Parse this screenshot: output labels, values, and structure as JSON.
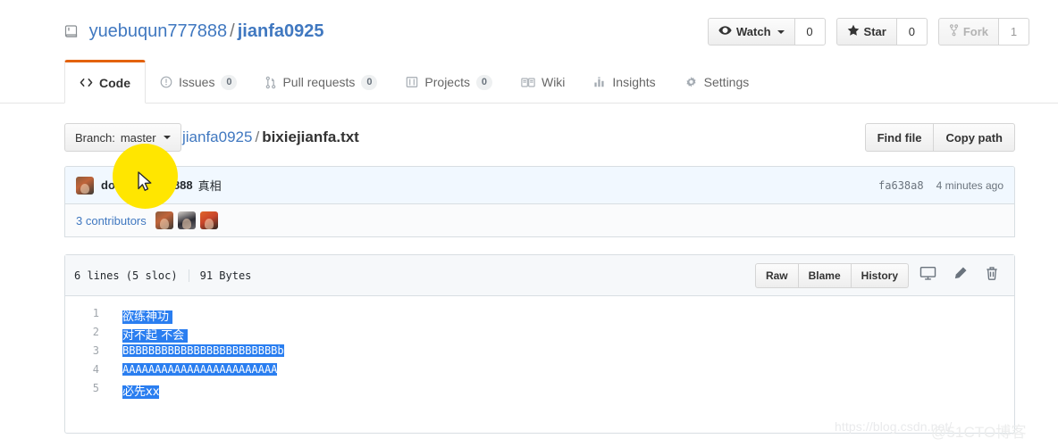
{
  "repo": {
    "owner": "yuebuqun777888",
    "separator": "/",
    "name": "jianfa0925",
    "icon": "repo-book-icon"
  },
  "actions": [
    {
      "label": "Watch",
      "count": "0",
      "icon": "eye-icon",
      "has_caret": true,
      "disabled": false
    },
    {
      "label": "Star",
      "count": "0",
      "icon": "star-icon",
      "has_caret": false,
      "disabled": false
    },
    {
      "label": "Fork",
      "count": "1",
      "icon": "fork-icon",
      "has_caret": false,
      "disabled": true
    }
  ],
  "nav": {
    "tabs": [
      {
        "label": "Code",
        "count": null,
        "icon": "code-icon",
        "selected": true
      },
      {
        "label": "Issues",
        "count": "0",
        "icon": "issue-opened-icon",
        "selected": false
      },
      {
        "label": "Pull requests",
        "count": "0",
        "icon": "git-pull-request-icon",
        "selected": false
      },
      {
        "label": "Projects",
        "count": "0",
        "icon": "project-board-icon",
        "selected": false
      },
      {
        "label": "Wiki",
        "count": null,
        "icon": "book-icon",
        "selected": false
      },
      {
        "label": "Insights",
        "count": null,
        "icon": "graph-icon",
        "selected": false
      },
      {
        "label": "Settings",
        "count": null,
        "icon": "gear-icon",
        "selected": false
      }
    ]
  },
  "file_navigation": {
    "branch_label": "Branch:",
    "branch_name": "master",
    "breadcrumb_repo": "jianfa0925",
    "breadcrumb_sep": "/",
    "breadcrumb_file": "bixiejianfa.txt",
    "find_file_label": "Find file",
    "copy_path_label": "Copy path"
  },
  "commit": {
    "author": "dongfang777888",
    "message": "真相",
    "sha": "fa638a8",
    "time": "4 minutes ago",
    "contributors_label": "3 contributors",
    "contributor_count": 3
  },
  "blob": {
    "lines_info": "6 lines (5 sloc)",
    "size": "91 Bytes",
    "raw_label": "Raw",
    "blame_label": "Blame",
    "history_label": "History",
    "icon_buttons": [
      "desktop-icon",
      "pencil-icon",
      "trash-icon"
    ],
    "code": [
      {
        "number": "1",
        "text": "欲练神功 ",
        "cjk": true
      },
      {
        "number": "2",
        "text": "对不起 不会 ",
        "cjk": true
      },
      {
        "number": "3",
        "text": "BBBBBBBBBBBBBBBBBBBBBBBBb",
        "cjk": false
      },
      {
        "number": "4",
        "text": "AAAAAAAAAAAAAAAAAAAAAAAA",
        "cjk": false
      },
      {
        "number": "5",
        "text": "必先xx",
        "cjk": true
      }
    ]
  },
  "watermark": {
    "url": "https://blog.csdn.net/",
    "brand": "@51CTO博客"
  },
  "colors": {
    "link": "#4078c0",
    "tab_accent": "#e36209",
    "selection": "#2a7ef0",
    "commit_bg": "#f1f8ff",
    "spotlight": "#ffe600"
  }
}
